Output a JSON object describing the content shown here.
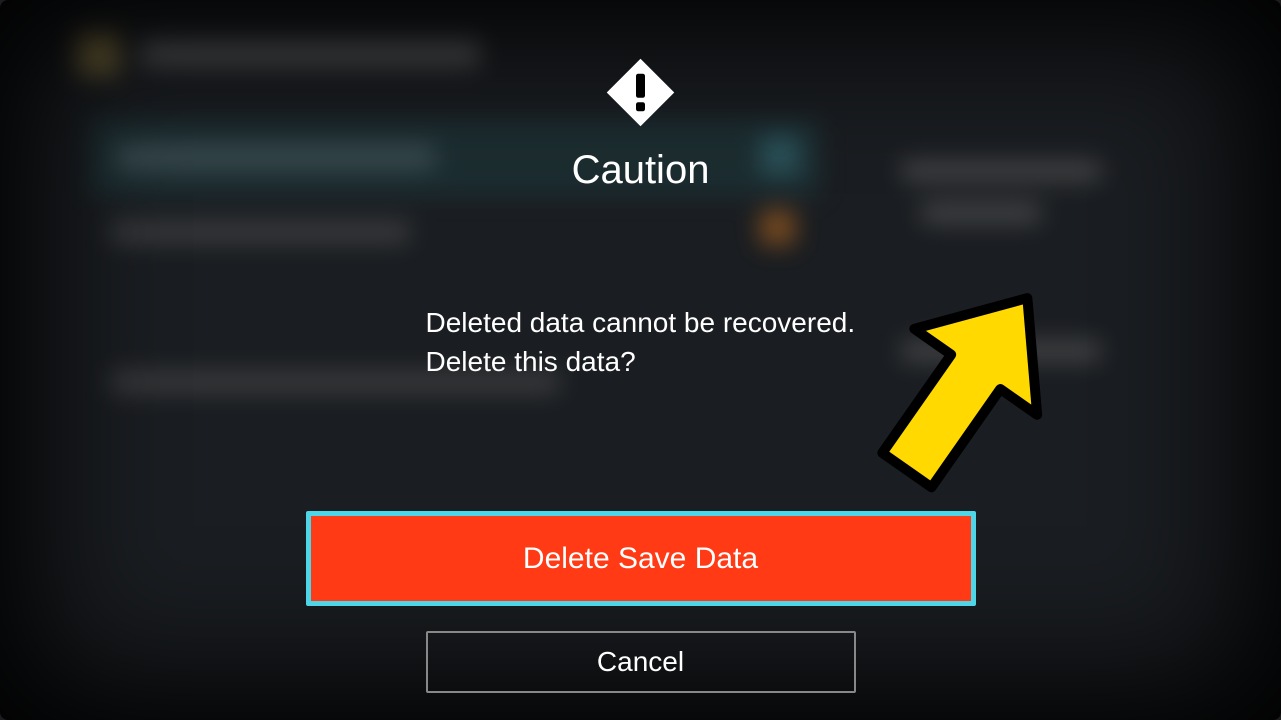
{
  "dialog": {
    "title": "Caution",
    "message_line1": "Deleted data cannot be recovered.",
    "message_line2": "Delete this data?",
    "primary_button": "Delete Save Data",
    "secondary_button": "Cancel"
  },
  "annotation": {
    "arrow_color": "#ffd900",
    "arrow_stroke": "#000000"
  }
}
